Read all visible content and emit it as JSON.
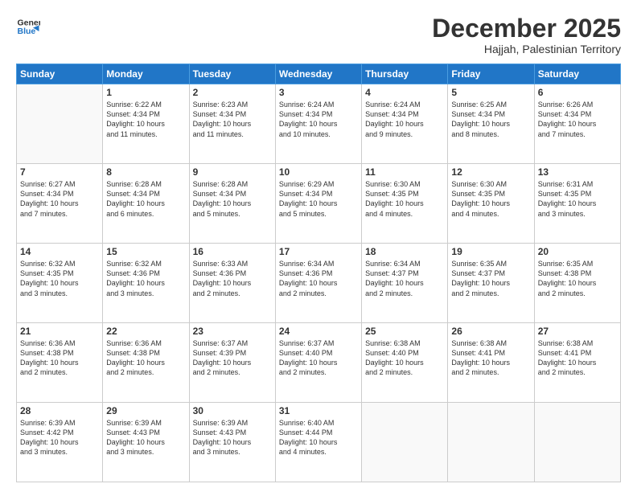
{
  "logo": {
    "line1": "General",
    "line2": "Blue"
  },
  "header": {
    "month_year": "December 2025",
    "location": "Hajjah, Palestinian Territory"
  },
  "days_of_week": [
    "Sunday",
    "Monday",
    "Tuesday",
    "Wednesday",
    "Thursday",
    "Friday",
    "Saturday"
  ],
  "weeks": [
    [
      {
        "day": "",
        "info": ""
      },
      {
        "day": "1",
        "info": "Sunrise: 6:22 AM\nSunset: 4:34 PM\nDaylight: 10 hours\nand 11 minutes."
      },
      {
        "day": "2",
        "info": "Sunrise: 6:23 AM\nSunset: 4:34 PM\nDaylight: 10 hours\nand 11 minutes."
      },
      {
        "day": "3",
        "info": "Sunrise: 6:24 AM\nSunset: 4:34 PM\nDaylight: 10 hours\nand 10 minutes."
      },
      {
        "day": "4",
        "info": "Sunrise: 6:24 AM\nSunset: 4:34 PM\nDaylight: 10 hours\nand 9 minutes."
      },
      {
        "day": "5",
        "info": "Sunrise: 6:25 AM\nSunset: 4:34 PM\nDaylight: 10 hours\nand 8 minutes."
      },
      {
        "day": "6",
        "info": "Sunrise: 6:26 AM\nSunset: 4:34 PM\nDaylight: 10 hours\nand 7 minutes."
      }
    ],
    [
      {
        "day": "7",
        "info": "Sunrise: 6:27 AM\nSunset: 4:34 PM\nDaylight: 10 hours\nand 7 minutes."
      },
      {
        "day": "8",
        "info": "Sunrise: 6:28 AM\nSunset: 4:34 PM\nDaylight: 10 hours\nand 6 minutes."
      },
      {
        "day": "9",
        "info": "Sunrise: 6:28 AM\nSunset: 4:34 PM\nDaylight: 10 hours\nand 5 minutes."
      },
      {
        "day": "10",
        "info": "Sunrise: 6:29 AM\nSunset: 4:34 PM\nDaylight: 10 hours\nand 5 minutes."
      },
      {
        "day": "11",
        "info": "Sunrise: 6:30 AM\nSunset: 4:35 PM\nDaylight: 10 hours\nand 4 minutes."
      },
      {
        "day": "12",
        "info": "Sunrise: 6:30 AM\nSunset: 4:35 PM\nDaylight: 10 hours\nand 4 minutes."
      },
      {
        "day": "13",
        "info": "Sunrise: 6:31 AM\nSunset: 4:35 PM\nDaylight: 10 hours\nand 3 minutes."
      }
    ],
    [
      {
        "day": "14",
        "info": "Sunrise: 6:32 AM\nSunset: 4:35 PM\nDaylight: 10 hours\nand 3 minutes."
      },
      {
        "day": "15",
        "info": "Sunrise: 6:32 AM\nSunset: 4:36 PM\nDaylight: 10 hours\nand 3 minutes."
      },
      {
        "day": "16",
        "info": "Sunrise: 6:33 AM\nSunset: 4:36 PM\nDaylight: 10 hours\nand 2 minutes."
      },
      {
        "day": "17",
        "info": "Sunrise: 6:34 AM\nSunset: 4:36 PM\nDaylight: 10 hours\nand 2 minutes."
      },
      {
        "day": "18",
        "info": "Sunrise: 6:34 AM\nSunset: 4:37 PM\nDaylight: 10 hours\nand 2 minutes."
      },
      {
        "day": "19",
        "info": "Sunrise: 6:35 AM\nSunset: 4:37 PM\nDaylight: 10 hours\nand 2 minutes."
      },
      {
        "day": "20",
        "info": "Sunrise: 6:35 AM\nSunset: 4:38 PM\nDaylight: 10 hours\nand 2 minutes."
      }
    ],
    [
      {
        "day": "21",
        "info": "Sunrise: 6:36 AM\nSunset: 4:38 PM\nDaylight: 10 hours\nand 2 minutes."
      },
      {
        "day": "22",
        "info": "Sunrise: 6:36 AM\nSunset: 4:38 PM\nDaylight: 10 hours\nand 2 minutes."
      },
      {
        "day": "23",
        "info": "Sunrise: 6:37 AM\nSunset: 4:39 PM\nDaylight: 10 hours\nand 2 minutes."
      },
      {
        "day": "24",
        "info": "Sunrise: 6:37 AM\nSunset: 4:40 PM\nDaylight: 10 hours\nand 2 minutes."
      },
      {
        "day": "25",
        "info": "Sunrise: 6:38 AM\nSunset: 4:40 PM\nDaylight: 10 hours\nand 2 minutes."
      },
      {
        "day": "26",
        "info": "Sunrise: 6:38 AM\nSunset: 4:41 PM\nDaylight: 10 hours\nand 2 minutes."
      },
      {
        "day": "27",
        "info": "Sunrise: 6:38 AM\nSunset: 4:41 PM\nDaylight: 10 hours\nand 2 minutes."
      }
    ],
    [
      {
        "day": "28",
        "info": "Sunrise: 6:39 AM\nSunset: 4:42 PM\nDaylight: 10 hours\nand 3 minutes."
      },
      {
        "day": "29",
        "info": "Sunrise: 6:39 AM\nSunset: 4:43 PM\nDaylight: 10 hours\nand 3 minutes."
      },
      {
        "day": "30",
        "info": "Sunrise: 6:39 AM\nSunset: 4:43 PM\nDaylight: 10 hours\nand 3 minutes."
      },
      {
        "day": "31",
        "info": "Sunrise: 6:40 AM\nSunset: 4:44 PM\nDaylight: 10 hours\nand 4 minutes."
      },
      {
        "day": "",
        "info": ""
      },
      {
        "day": "",
        "info": ""
      },
      {
        "day": "",
        "info": ""
      }
    ]
  ]
}
